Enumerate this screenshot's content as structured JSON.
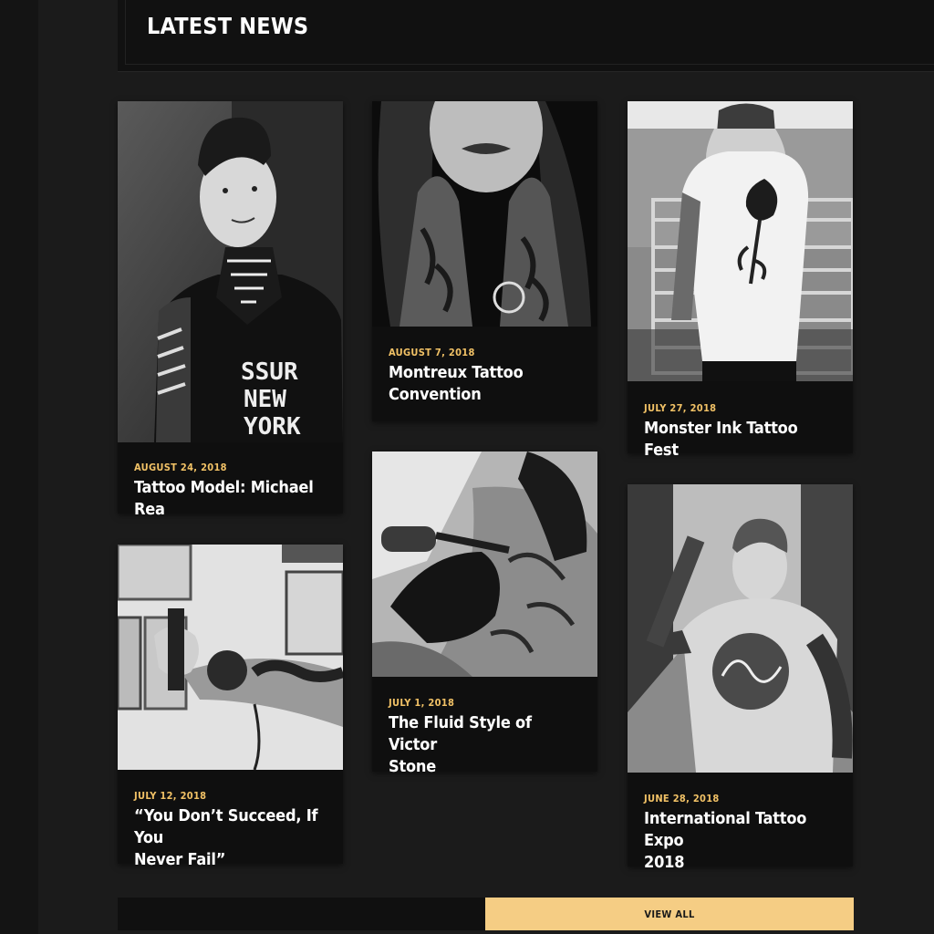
{
  "section": {
    "title": "LATEST NEWS"
  },
  "posts": [
    {
      "date": "AUGUST 24, 2018",
      "title": "Tattoo Model: Michael Rea"
    },
    {
      "date": "AUGUST 7, 2018",
      "title_line1": "Montreux Tattoo",
      "title_line2": "Convention"
    },
    {
      "date": "JULY 27, 2018",
      "title": "Monster Ink Tattoo Fest"
    },
    {
      "date": "JULY 12, 2018",
      "title_line1": "“You Don’t Succeed, If You",
      "title_line2": "Never Fail”"
    },
    {
      "date": "JULY 1, 2018",
      "title_line1": "The Fluid Style of Victor",
      "title_line2": "Stone"
    },
    {
      "date": "JUNE 28, 2018",
      "title_line1": "International Tattoo Expo",
      "title_line2": "2018"
    }
  ],
  "shirt_text": {
    "line1": "SSUR",
    "line2": "NEW",
    "line3": "YORK"
  },
  "view_all_label": "VIEW ALL",
  "colors": {
    "accent": "#f5cd84",
    "date": "#f2c266",
    "background": "#1b1b1b",
    "card": "#0f0f0f"
  }
}
